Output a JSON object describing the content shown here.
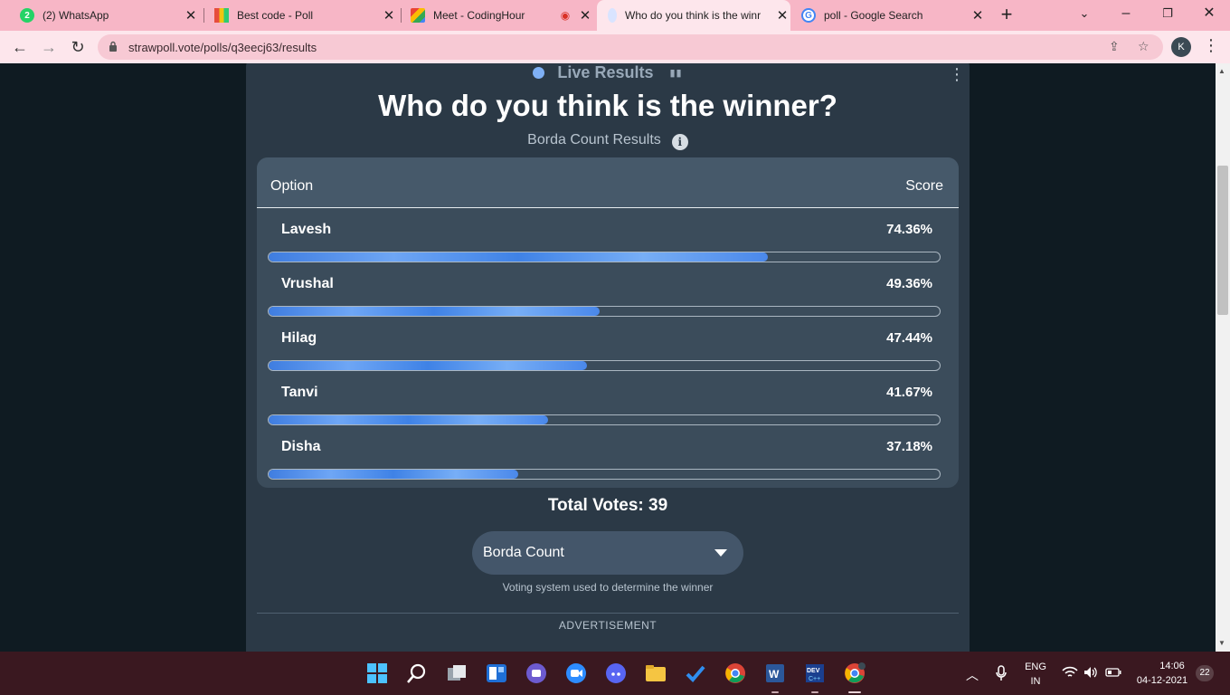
{
  "browser": {
    "tabs": [
      {
        "title": "(2) WhatsApp",
        "badge": "2"
      },
      {
        "title": "Best code - Poll"
      },
      {
        "title": "Meet - CodingHour"
      },
      {
        "title": "Who do you think is the winr"
      },
      {
        "title": "poll - Google Search"
      }
    ],
    "url": "strawpoll.vote/polls/q3eecj63/results",
    "avatar_letter": "K"
  },
  "poll": {
    "live_label": "Live Results",
    "question": "Who do you think is the winner?",
    "subtitle": "Borda Count Results",
    "col_option": "Option",
    "col_score": "Score",
    "options": [
      {
        "name": "Lavesh",
        "score": "74.36%",
        "value": 74.36
      },
      {
        "name": "Vrushal",
        "score": "49.36%",
        "value": 49.36
      },
      {
        "name": "Hilag",
        "score": "47.44%",
        "value": 47.44
      },
      {
        "name": "Tanvi",
        "score": "41.67%",
        "value": 41.67
      },
      {
        "name": "Disha",
        "score": "37.18%",
        "value": 37.18
      }
    ],
    "total_votes": "Total Votes: 39",
    "system_select": "Borda Count",
    "system_helper": "Voting system used to determine the winner",
    "advertisement": "ADVERTISEMENT"
  },
  "taskbar": {
    "lang_top": "ENG",
    "lang_bottom": "IN",
    "time": "14:06",
    "date": "04-12-2021",
    "notif_count": "22"
  },
  "colors": {
    "accent": "#3f7de0",
    "card": "#2b3946",
    "results_bg": "#3b4c5b",
    "chrome": "#f7b6c6"
  }
}
